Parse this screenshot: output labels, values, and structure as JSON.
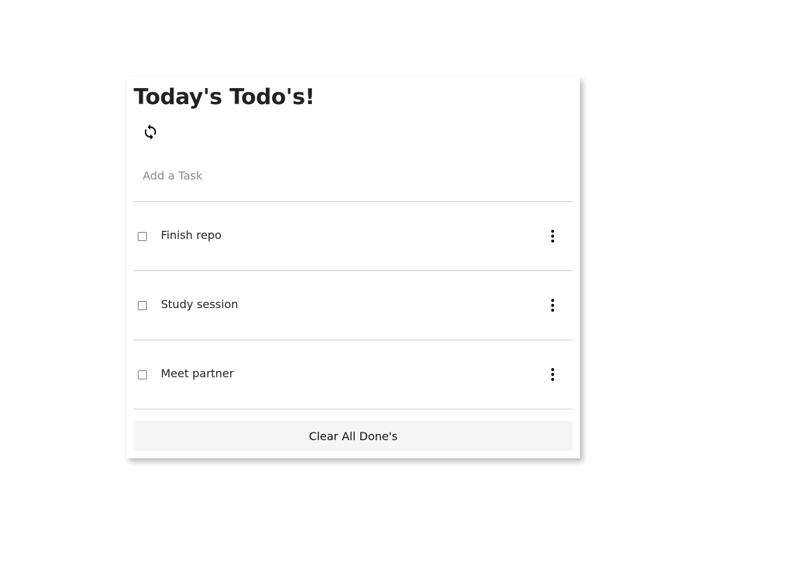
{
  "header": {
    "title": "Today's Todo's!",
    "refresh_icon": "refresh-icon"
  },
  "add_task": {
    "placeholder": "Add a Task",
    "value": ""
  },
  "tasks": [
    {
      "label": "Finish repo",
      "done": false,
      "menu_icon": "more-vertical-icon"
    },
    {
      "label": "Study session",
      "done": false,
      "menu_icon": "more-vertical-icon"
    },
    {
      "label": "Meet partner",
      "done": false,
      "menu_icon": "more-vertical-icon"
    }
  ],
  "footer": {
    "clear_label": "Clear All Done's"
  },
  "colors": {
    "divider": "#cccccc",
    "button_bg": "#f5f5f5",
    "placeholder": "#8a8a8a"
  }
}
